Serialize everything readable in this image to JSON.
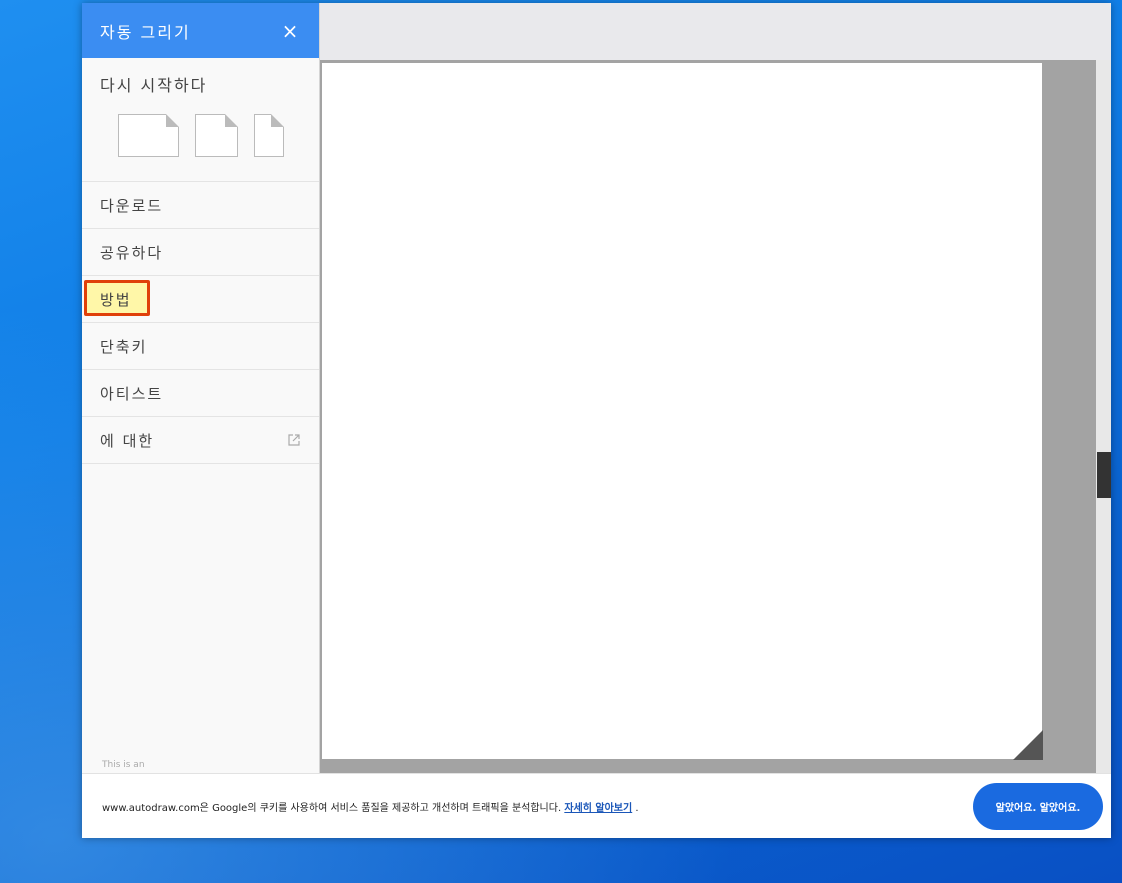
{
  "sidebar": {
    "title": "자동 그리기",
    "close_icon": "×",
    "restart_label": "다시 시작하다",
    "menu": [
      {
        "label": "다운로드"
      },
      {
        "label": "공유하다"
      },
      {
        "label": "방법"
      },
      {
        "label": "단축키"
      },
      {
        "label": "아티스트"
      },
      {
        "label": "에 대한"
      }
    ],
    "experiment_note": "This is an"
  },
  "cookie": {
    "text": "www.autodraw.com은 Google의 쿠키를 사용하여 서비스 품질을 제공하고 개선하며 트래픽을 분석합니다.",
    "link": "자세히 알아보기",
    "after_link": ".",
    "button": "알았어요. 알았어요."
  },
  "colors": {
    "header_blue": "#3b8df2",
    "highlight_border": "#e0400a",
    "highlight_fill": "#fff7a8",
    "button_blue": "#1a6ae0"
  },
  "icons": {
    "close": "close-icon",
    "external_link": "external-link-icon",
    "resize": "resize-handle-icon"
  }
}
